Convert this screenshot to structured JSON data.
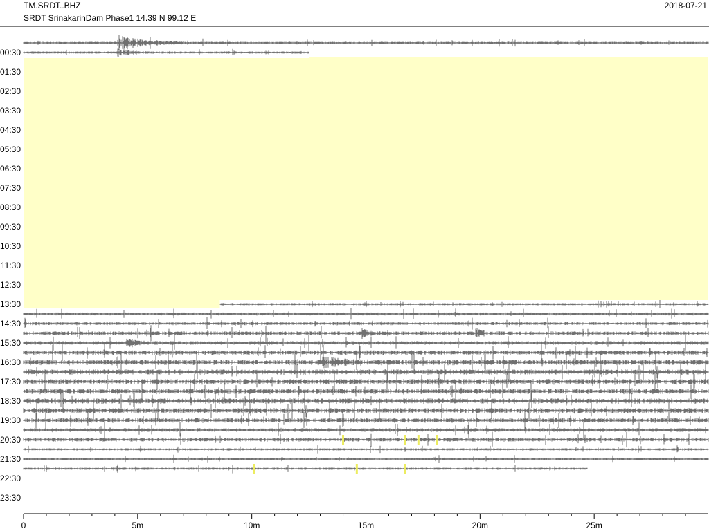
{
  "header": {
    "station_code": "TM.SRDT..BHZ",
    "station_description": "SRDT SrinakarinDam Phase1  14.39 N 99.12 E",
    "date": "2018-07-21"
  },
  "chart_data": {
    "type": "helicorder",
    "title": "TM.SRDT..BHZ",
    "subtitle": "SRDT SrinakarinDam Phase1  14.39 N 99.12 E",
    "date": "2018-07-21",
    "xlabel": "",
    "ylabel": "",
    "x_unit": "minutes",
    "xlim": [
      0,
      30
    ],
    "x_tick_values": [
      0,
      5,
      10,
      15,
      20,
      25
    ],
    "x_tick_labels": [
      "0",
      "5m",
      "10m",
      "15m",
      "20m",
      "25m"
    ],
    "x_minor_tick_step": 1,
    "line_minutes": 30,
    "line_count": 48,
    "y_tick_labels": [
      "00:30",
      "01:30",
      "02:30",
      "03:30",
      "04:30",
      "05:30",
      "06:30",
      "07:30",
      "08:30",
      "09:30",
      "10:30",
      "11:30",
      "12:30",
      "13:30",
      "14:30",
      "15:30",
      "16:30",
      "17:30",
      "18:30",
      "19:30",
      "20:30",
      "21:30",
      "22:30",
      "23:30"
    ],
    "colors": {
      "trace": "#707070",
      "gap": "#ffffc8",
      "event_marker": "#ecec60",
      "axis": "#000000"
    },
    "gap": {
      "start_row": 1,
      "start_minute": 12.5,
      "end_row": 27,
      "end_minute": 8.6
    },
    "data_end": {
      "row": 44,
      "minute": 24.7
    },
    "noise_level_by_row": [
      2,
      2,
      0,
      0,
      0,
      0,
      0,
      0,
      0,
      0,
      0,
      0,
      0,
      0,
      0,
      0,
      0,
      0,
      0,
      0,
      0,
      0,
      0,
      0,
      0,
      0,
      0,
      2,
      3,
      3,
      4,
      4,
      5,
      6,
      6,
      6,
      6,
      6,
      6,
      5,
      4,
      4,
      2,
      2,
      2,
      0,
      0,
      0
    ],
    "events": [
      {
        "row": 0,
        "start_minute": 4.1,
        "end_minute": 7.2,
        "amplitude": 4,
        "label": "earthquake"
      },
      {
        "row": 1,
        "start_minute": 4.1,
        "end_minute": 5.5,
        "amplitude": 2,
        "label": "earthquake coda"
      },
      {
        "row": 31,
        "start_minute": 4.5,
        "end_minute": 5.6,
        "amplitude": 2,
        "label": "burst"
      },
      {
        "row": 30,
        "start_minute": 14.8,
        "end_minute": 15.6,
        "amplitude": 2,
        "label": "burst"
      },
      {
        "row": 30,
        "start_minute": 19.8,
        "end_minute": 21.0,
        "amplitude": 2,
        "label": "burst"
      },
      {
        "row": 33,
        "start_minute": 13.1,
        "end_minute": 16.0,
        "amplitude": 2,
        "label": "burst"
      }
    ],
    "event_markers": [
      {
        "row": 41,
        "minute": 14.0
      },
      {
        "row": 41,
        "minute": 16.7
      },
      {
        "row": 41,
        "minute": 17.3
      },
      {
        "row": 41,
        "minute": 18.1
      },
      {
        "row": 44,
        "minute": 10.1
      },
      {
        "row": 44,
        "minute": 14.6
      },
      {
        "row": 44,
        "minute": 16.7
      }
    ]
  }
}
